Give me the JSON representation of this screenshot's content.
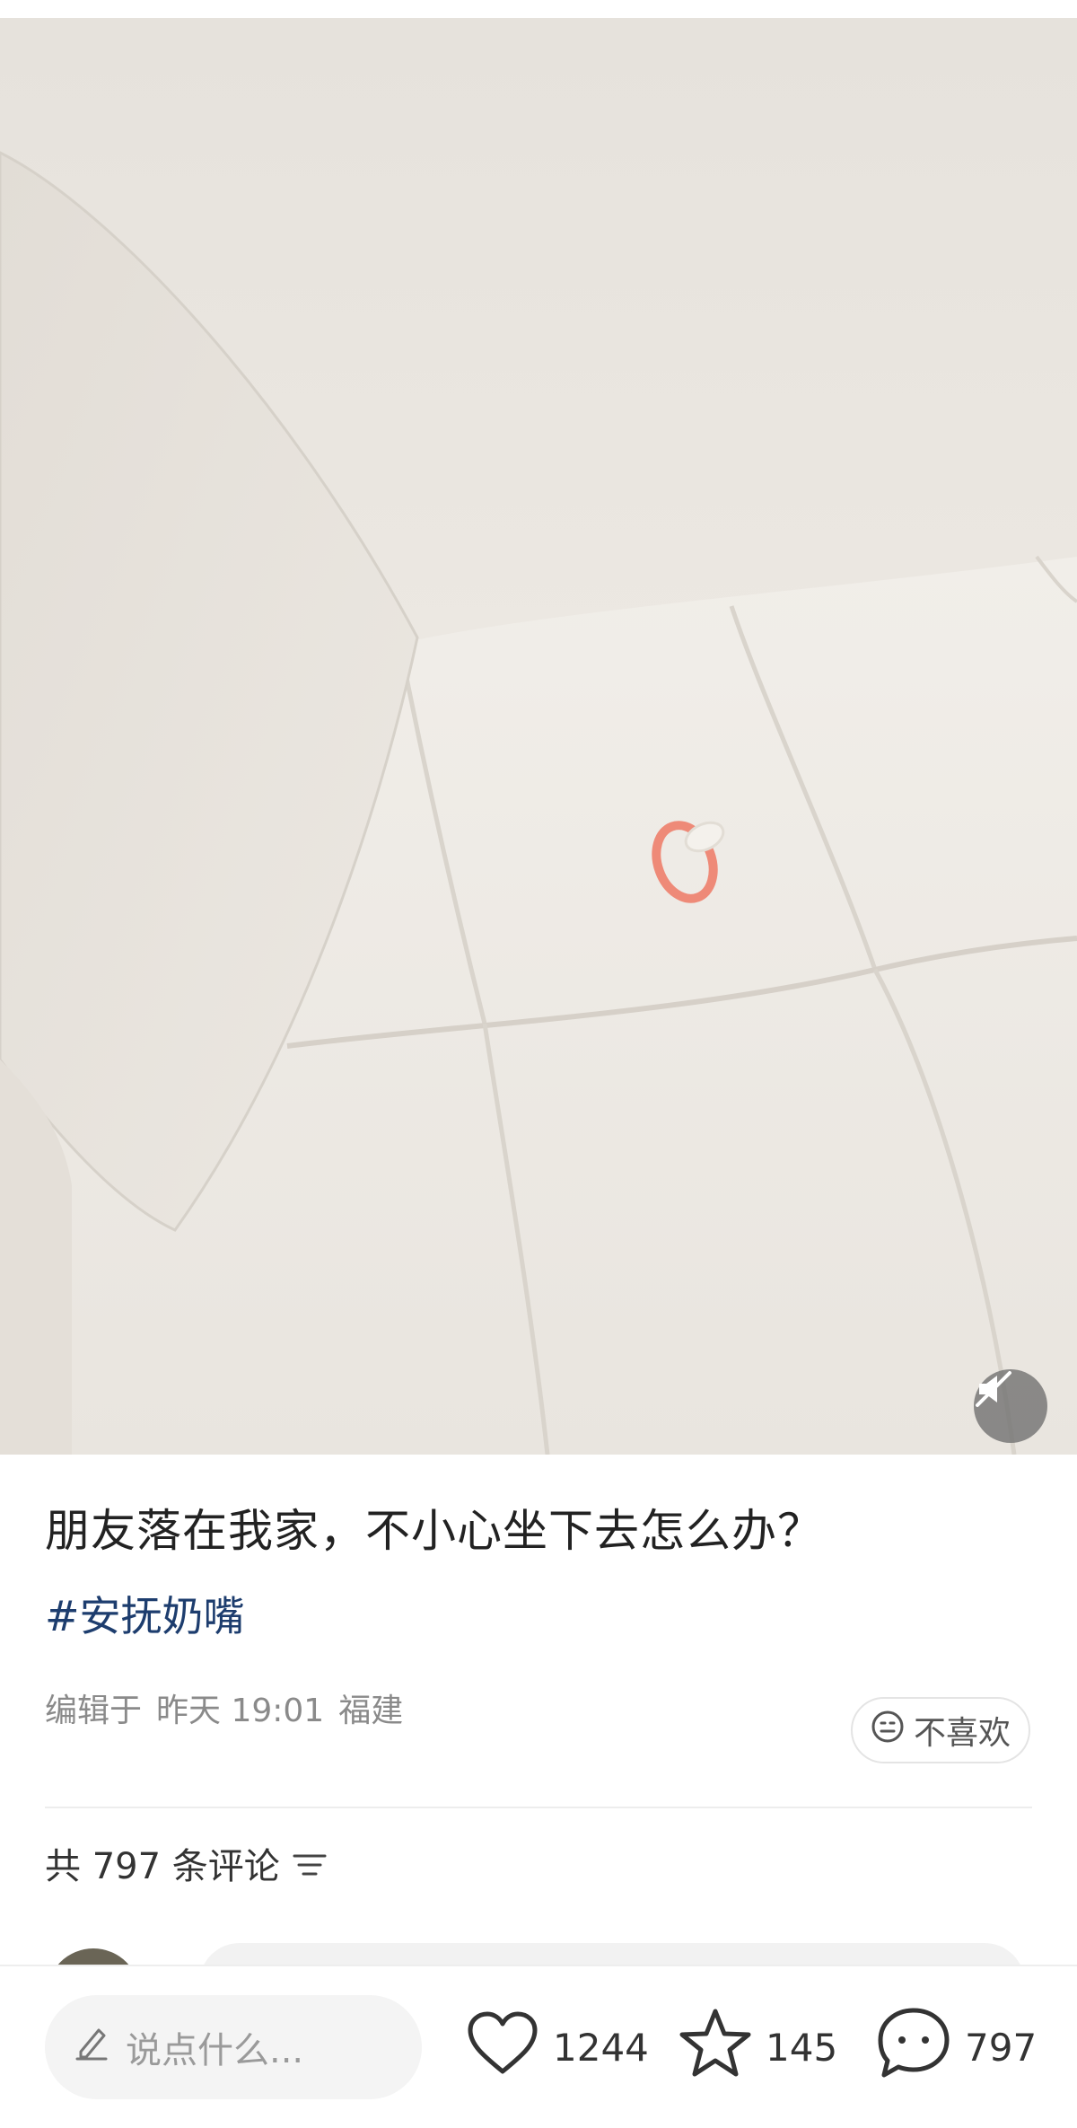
{
  "post": {
    "title": "朋友落在我家，不小心坐下去怎么办？",
    "tag": "#安抚奶嘴",
    "meta": {
      "edited": "编辑于",
      "time": "昨天 19:01",
      "location": "福建"
    },
    "dislike_label": "不喜欢"
  },
  "comments": {
    "header": "共 797 条评论"
  },
  "bottom_bar": {
    "input_placeholder": "说点什么...",
    "likes": "1244",
    "favorites": "145",
    "comments": "797"
  },
  "icons": {
    "mute": "speaker-muted-icon",
    "dislike": "neutral-face-icon",
    "sort": "sort-lines-icon",
    "pencil": "pencil-icon",
    "like": "heart-icon",
    "favorite": "star-icon",
    "comment": "chat-bubble-icon"
  },
  "colors": {
    "tag": "#1d3d6e",
    "text": "#222222",
    "muted": "#8a8a8a"
  }
}
